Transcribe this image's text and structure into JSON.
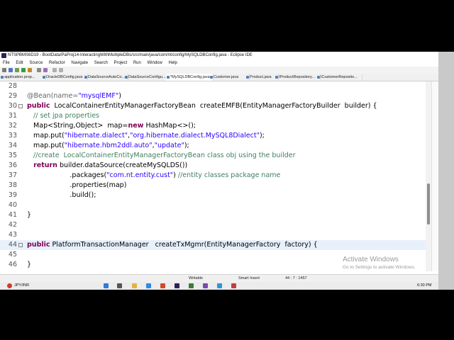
{
  "window": {
    "title": "NTSPBMS6D19 - BootData/PaProj14-InteractingWithMultipleDBs/src/main/java/com/nt/config/MySQLDBConfig.java - Eclipse IDE"
  },
  "menu": [
    "File",
    "Edit",
    "Source",
    "Refactor",
    "Navigate",
    "Search",
    "Project",
    "Run",
    "Window",
    "Help"
  ],
  "tabs": [
    "application.prop...",
    "OracleDBConfig.java",
    "DataSourceAutoCo...",
    "DataSourceConfigu...",
    "*MySQLDBConfig.java",
    "Customer.java",
    "Product.java",
    "IProductRepository...",
    "ICustomerReposito..."
  ],
  "active_tab_index": 4,
  "editor": {
    "lines": [
      {
        "n": "28",
        "t": "",
        "tok": []
      },
      {
        "n": "29",
        "t": "@Bean(name=\"mysqlEMF\")",
        "tok": [
          [
            "@Bean(name=",
            "ann"
          ],
          [
            "\"mysqlEMF\"",
            "str"
          ],
          [
            ")",
            ""
          ]
        ]
      },
      {
        "n": "30",
        "t": "public  LocalContainerEntityManagerFactoryBean  createEMFB(EntityManagerFactoryBuilder  builder) {",
        "tok": [
          [
            "public",
            "kw"
          ],
          [
            "  LocalContainerEntityManagerFactoryBean  createEMFB(EntityManagerFactoryBuilder  builder) {",
            ""
          ]
        ]
      },
      {
        "n": "31",
        "t": "   // set jpa properties",
        "tok": [
          [
            "   // set jpa properties",
            "cmt"
          ]
        ]
      },
      {
        "n": "32",
        "t": "   Map<String,Object>  map=new HashMap<>();",
        "tok": [
          [
            "   Map<String,Object>  map=",
            ""
          ],
          [
            "new",
            "kw"
          ],
          [
            " HashMap<>();",
            ""
          ]
        ]
      },
      {
        "n": "33",
        "t": "   map.put(\"hibernate.dialect\",\"org.hibernate.dialect.MySQL8Dialect\");",
        "tok": [
          [
            "   map.put(",
            ""
          ],
          [
            "\"hibernate.dialect\"",
            "str"
          ],
          [
            ",",
            ""
          ],
          [
            "\"org.hibernate.dialect.MySQL8Dialect\"",
            "str"
          ],
          [
            ");",
            ""
          ]
        ]
      },
      {
        "n": "34",
        "t": "   map.put(\"hibernate.hbm2ddl.auto\",\"update\");",
        "tok": [
          [
            "   map.put(",
            ""
          ],
          [
            "\"hibernate.hbm2ddl.auto\"",
            "str"
          ],
          [
            ",",
            ""
          ],
          [
            "\"update\"",
            "str"
          ],
          [
            ");",
            ""
          ]
        ]
      },
      {
        "n": "35",
        "t": "   //create  LocalContainerEntityManagerFactoryBean class obj using the builder",
        "tok": [
          [
            "   //create  LocalContainerEntityManagerFactoryBean class obj using the builder",
            "cmt"
          ]
        ]
      },
      {
        "n": "36",
        "t": "   return builder.dataSource(createMySQLDS())",
        "tok": [
          [
            "   ",
            ""
          ],
          [
            "return",
            "kw"
          ],
          [
            " builder.dataSource(createMySQLDS())",
            ""
          ]
        ]
      },
      {
        "n": "37",
        "t": "                    .packages(\"com.nt.entity.cust\") //entity classes package name",
        "tok": [
          [
            "                    .packages(",
            ""
          ],
          [
            "\"com.nt.entity.cust\"",
            "str"
          ],
          [
            ") ",
            ""
          ],
          [
            "//entity classes package name",
            "cmt"
          ]
        ]
      },
      {
        "n": "38",
        "t": "                    .properties(map)",
        "tok": [
          [
            "                    .properties(map)",
            ""
          ]
        ]
      },
      {
        "n": "39",
        "t": "                    .build();",
        "tok": [
          [
            "                    .build();",
            ""
          ]
        ]
      },
      {
        "n": "40",
        "t": "",
        "tok": []
      },
      {
        "n": "41",
        "t": "}",
        "tok": [
          [
            "}",
            ""
          ]
        ]
      },
      {
        "n": "42",
        "t": "",
        "tok": []
      },
      {
        "n": "43",
        "t": "",
        "tok": []
      },
      {
        "n": "44",
        "t": "public PlatformTransactionManager   createTxMgmr(EntityManagerFactory  factory) {",
        "tok": [
          [
            "public",
            "kw"
          ],
          [
            " PlatformTransactionManager   createTxMgmr(EntityManagerFactory  factory) {",
            ""
          ]
        ]
      },
      {
        "n": "45",
        "t": "",
        "tok": []
      },
      {
        "n": "46",
        "t": "}",
        "tok": [
          [
            "}",
            ""
          ]
        ]
      }
    ],
    "highlight_line": "44"
  },
  "watermark": {
    "line1": "Activate Windows",
    "line2": "Go to Settings to activate Windows."
  },
  "status": {
    "writable": "Writable",
    "insert_mode": "Smart Insert",
    "position": "44 : 7 : 1457"
  },
  "taskbar": {
    "currency": "JPY/INR",
    "time": "6:30 PM"
  }
}
